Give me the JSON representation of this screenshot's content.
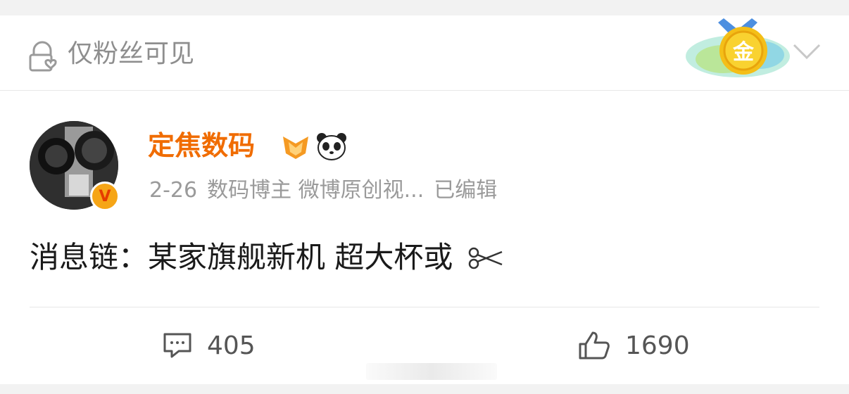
{
  "visibility": {
    "label": "仅粉丝可见",
    "icon": "lock-heart-icon"
  },
  "medal": {
    "label": "金",
    "icon": "gold-medal-icon"
  },
  "menu": {
    "icon": "chevron-down-icon"
  },
  "author": {
    "name": "定焦数码",
    "verified_badge": "V",
    "level_icon": "vip-level-icon",
    "emoji_icon": "panda-icon"
  },
  "meta": {
    "date": "2-26",
    "role": "数码博主 微博原创视...",
    "edited": "已编辑"
  },
  "post": {
    "text": "消息链：某家旗舰新机 超大杯或"
  },
  "actions": {
    "comments": "405",
    "likes": "1690"
  },
  "colors": {
    "author": "#f06c00",
    "text": "#1a1a1a",
    "muted": "#9a9a9a",
    "badge": "#f6a516"
  }
}
